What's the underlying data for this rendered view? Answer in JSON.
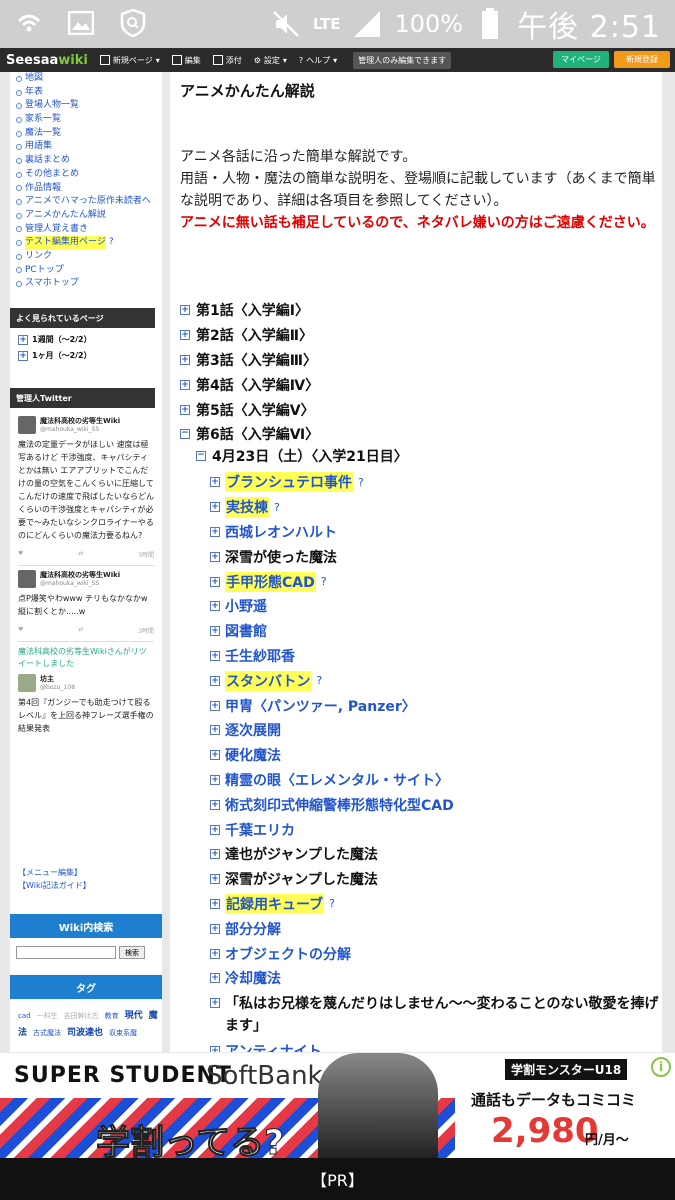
{
  "status_bar": {
    "network": "LTE",
    "battery": "100%",
    "time": "午後 2:51",
    "wifi_label": "ON"
  },
  "wiki_bar": {
    "logo_a": "Seesaa",
    "logo_b": "wiki",
    "items": [
      "新規ページ",
      "編集",
      "添付",
      "設定",
      "ヘルプ"
    ],
    "admin_note": "管理人のみ編集できます",
    "mypage": "マイページ",
    "signup": "新規登録"
  },
  "sidebar": {
    "links": [
      {
        "label": "地図",
        "hl": false
      },
      {
        "label": "年表",
        "hl": false
      },
      {
        "label": "登場人物一覧",
        "hl": false
      },
      {
        "label": "家系一覧",
        "hl": false
      },
      {
        "label": "魔法一覧",
        "hl": false
      },
      {
        "label": "用語集",
        "hl": false
      },
      {
        "label": "裏話まとめ",
        "hl": false
      },
      {
        "label": "その他まとめ",
        "hl": false
      },
      {
        "label": "作品情報",
        "hl": false
      },
      {
        "label": "アニメでハマった原作未読者へ",
        "hl": false
      },
      {
        "label": "アニメかんたん解説",
        "hl": false
      },
      {
        "label": "管理人覚え書き",
        "hl": false
      },
      {
        "label": "テスト編集用ページ",
        "hl": true
      },
      {
        "label": "リンク",
        "hl": false
      },
      {
        "label": "PCトップ",
        "hl": false
      },
      {
        "label": "スマホトップ",
        "hl": false
      }
    ],
    "popular_head": "よく見られているページ",
    "popular": [
      "1週間（〜2/2）",
      "1ヶ月（〜2/2）"
    ],
    "twitter_head": "管理人Twitter",
    "tweets": [
      {
        "name": "魔法科高校の劣等生Wiki",
        "handle": "@mahouka_wiki_SS",
        "body": "魔法の定量データがほしい 速度は極写あるけど 干渉強度、キャパシティとかは無い エアアプリットでこんだけの量の空気をこんくらいに圧縮してこんだけの速度で飛ばしたいならどんくらいの干渉強度とキャパシティが必要で〜みたいなシンクロライナーやるのにどんくらいの魔法力要るねん?",
        "time": "3時間"
      },
      {
        "name": "魔法科高校の劣等生Wiki",
        "handle": "@mahouka_wiki_SS",
        "body": "点P爆笑やわwww チリもなかなかw 縦に割くとか.....w",
        "time": "3時間"
      }
    ],
    "retweet": {
      "line": "魔法科高校の劣等生Wikiさんがリツイートしました",
      "name": "坊主",
      "handle": "@bozu_108",
      "body": "第4回『ガンジーでも助走つけて殴るレベル』を上回る神フレーズ選手権の結果発表"
    },
    "menu_edit": [
      "【メニュー編集】",
      "【Wiki記法ガイド】"
    ],
    "search_head": "Wiki内検索",
    "search_btn": "検索",
    "tag_head": "タグ",
    "tags": [
      {
        "label": "cad",
        "cls": ""
      },
      {
        "label": "一科生",
        "cls": "t-light"
      },
      {
        "label": "吉田幹比古",
        "cls": "t-light"
      },
      {
        "label": "教育",
        "cls": ""
      },
      {
        "label": "現代",
        "cls": "t-bold"
      },
      {
        "label": "魔法",
        "cls": "t-bold"
      },
      {
        "label": "古式魔法",
        "cls": ""
      },
      {
        "label": "司波達也",
        "cls": "t-bold"
      },
      {
        "label": "収束系魔",
        "cls": ""
      }
    ]
  },
  "main": {
    "title": "アニメかんたん解説",
    "intro_1": "アニメ各話に沿った簡単な解説です。",
    "intro_2": "用語・人物・魔法の簡単な説明を、登場順に記載しています（あくまで簡単な説明であり、詳細は各項目を参照してください）。",
    "warning": "アニメに無い話も補足しているので、ネタバレ嫌いの方はご遠慮ください。",
    "episodes": [
      {
        "label": "第1話〈入学編Ⅰ〉",
        "open": false
      },
      {
        "label": "第2話〈入学編Ⅱ〉",
        "open": false
      },
      {
        "label": "第3話〈入学編Ⅲ〉",
        "open": false
      },
      {
        "label": "第4話〈入学編Ⅳ〉",
        "open": false
      },
      {
        "label": "第5話〈入学編Ⅴ〉",
        "open": false
      },
      {
        "label": "第6話〈入学編Ⅵ〉",
        "open": true
      }
    ],
    "date_heading": "4月23日（土）〈入学21日目〉",
    "topics": [
      {
        "label": "ブランシュテロ事件",
        "style": "hl"
      },
      {
        "label": "実技棟",
        "style": "hl"
      },
      {
        "label": "西城レオンハルト",
        "style": "link"
      },
      {
        "label": "深雪が使った魔法",
        "style": "black"
      },
      {
        "label": "手甲形態CAD",
        "style": "hl"
      },
      {
        "label": "小野遥",
        "style": "link"
      },
      {
        "label": "図書館",
        "style": "link"
      },
      {
        "label": "壬生紗耶香",
        "style": "link"
      },
      {
        "label": "スタンバトン",
        "style": "hl"
      },
      {
        "label": "甲冑〈パンツァー, Panzer〉",
        "style": "link"
      },
      {
        "label": "逐次展開",
        "style": "link"
      },
      {
        "label": "硬化魔法",
        "style": "link"
      },
      {
        "label": "精霊の眼〈エレメンタル・サイト〉",
        "style": "link"
      },
      {
        "label": "術式刻印式伸縮警棒形態特化型CAD",
        "style": "link"
      },
      {
        "label": "千葉エリカ",
        "style": "link"
      },
      {
        "label": "達也がジャンプした魔法",
        "style": "black"
      },
      {
        "label": "深雪がジャンプした魔法",
        "style": "black"
      },
      {
        "label": "記録用キューブ",
        "style": "hl"
      },
      {
        "label": "部分分解",
        "style": "link"
      },
      {
        "label": "オブジェクトの分解",
        "style": "link"
      },
      {
        "label": "冷却魔法",
        "style": "link"
      },
      {
        "label": "「私はお兄様を蔑んだりはしません〜〜変わることのない敬愛を捧げます」",
        "style": "multi"
      },
      {
        "label": "アンティナイト",
        "style": "link"
      }
    ]
  },
  "ad": {
    "title": "SUPER STUDENT",
    "brand": "SoftBank",
    "slogan": "学割ってる?",
    "label": "学割モンスターU18",
    "line": "通話もデータもコミコミ",
    "price": "2,980",
    "unit": "円/月〜",
    "pr": "【PR】"
  }
}
